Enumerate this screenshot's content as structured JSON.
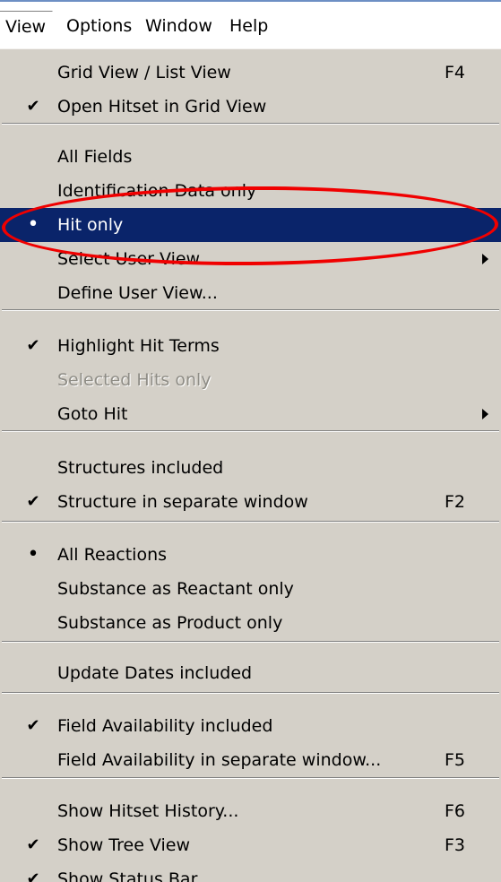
{
  "menubar": {
    "items": [
      {
        "label": "View",
        "active": true
      },
      {
        "label": "Options",
        "active": false
      },
      {
        "label": "Window",
        "active": false
      },
      {
        "label": "Help",
        "active": false
      }
    ]
  },
  "menu": {
    "groups": [
      [
        {
          "label": "Grid View / List View",
          "shortcut": "F4"
        },
        {
          "label": "Open Hitset in Grid View",
          "mark": "check"
        }
      ],
      [
        {
          "label": "All Fields"
        },
        {
          "label": "Identification Data only"
        },
        {
          "label": "Hit only",
          "mark": "bullet",
          "selected": true
        },
        {
          "label": "Select User View",
          "submenu": true
        },
        {
          "label": "Define User View..."
        }
      ],
      [
        {
          "label": "Highlight Hit Terms",
          "mark": "check"
        },
        {
          "label": "Selected Hits only",
          "disabled": true
        },
        {
          "label": "Goto Hit",
          "submenu": true
        }
      ],
      [
        {
          "label": "Structures included"
        },
        {
          "label": "Structure in separate window",
          "mark": "check",
          "shortcut": "F2"
        }
      ],
      [
        {
          "label": "All Reactions",
          "mark": "bullet"
        },
        {
          "label": "Substance as Reactant only"
        },
        {
          "label": "Substance as Product only"
        }
      ],
      [
        {
          "label": "Update Dates included"
        }
      ],
      [
        {
          "label": "Field Availability included",
          "mark": "check"
        },
        {
          "label": "Field Availability in separate window...",
          "shortcut": "F5"
        }
      ],
      [
        {
          "label": "Show Hitset History...",
          "shortcut": "F6"
        },
        {
          "label": "Show Tree View",
          "mark": "check",
          "shortcut": "F3"
        },
        {
          "label": "Show Status Bar",
          "mark": "check"
        }
      ]
    ]
  },
  "annotation": {
    "color": "#f00000",
    "target": "Hit only"
  },
  "colors": {
    "menu_background": "#d4d0c8",
    "selection": "#0a246a",
    "menubar_background": "#ffffff"
  }
}
